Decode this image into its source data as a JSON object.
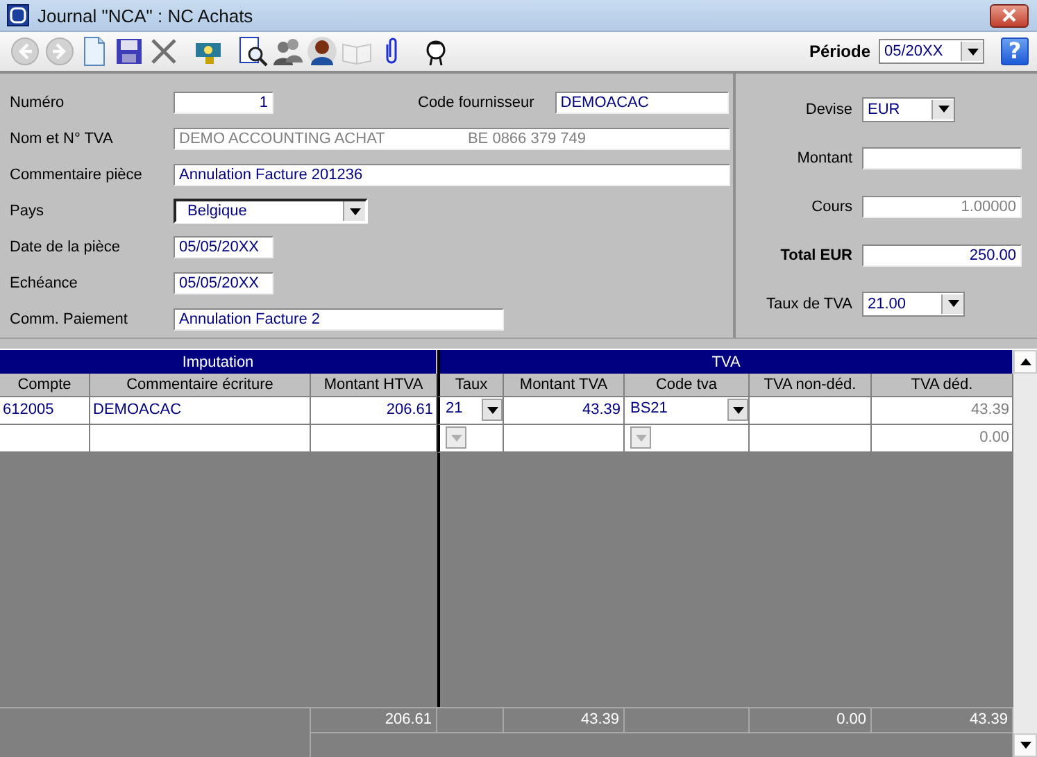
{
  "window": {
    "title": "Journal \"NCA\" : NC Achats"
  },
  "toolbar": {
    "buttons": [
      {
        "kind": "back",
        "disabled": true
      },
      {
        "kind": "forward",
        "disabled": true
      },
      {
        "kind": "new",
        "disabled": false
      },
      {
        "kind": "save",
        "disabled": false
      },
      {
        "kind": "delete",
        "disabled": false
      },
      {
        "kind": "money",
        "disabled": false
      },
      {
        "kind": "preview",
        "disabled": false
      },
      {
        "kind": "users",
        "disabled": false
      },
      {
        "kind": "person",
        "disabled": false
      },
      {
        "kind": "book",
        "disabled": true
      },
      {
        "kind": "clip",
        "disabled": false
      },
      {
        "kind": "face",
        "disabled": false
      }
    ],
    "periode_label": "Période",
    "periode": "05/20XX",
    "help": "?"
  },
  "form": {
    "numero": {
      "label": "Numéro",
      "value": "1"
    },
    "code_fournisseur": {
      "label": "Code fournisseur",
      "value": "DEMOACAC"
    },
    "nom_tva": {
      "label": "Nom et N° TVA",
      "name": "DEMO ACCOUNTING ACHAT",
      "vat": "BE 0866 379 749",
      "disabled": true
    },
    "commentaire": {
      "label": "Commentaire pièce",
      "value": "Annulation Facture 201236"
    },
    "pays": {
      "label": "Pays",
      "value": "Belgique"
    },
    "date": {
      "label": "Date de la pièce",
      "value": "05/05/20XX"
    },
    "echeance": {
      "label": "Echéance",
      "value": "05/05/20XX"
    },
    "comm_paiement": {
      "label": "Comm. Paiement",
      "value": "Annulation Facture 2"
    }
  },
  "currency": {
    "devise": {
      "label": "Devise",
      "value": "EUR"
    },
    "montant": {
      "label": "Montant"
    },
    "cours": {
      "label": "Cours",
      "value": "1.00000",
      "disabled": true
    },
    "total": {
      "label": "Total EUR",
      "value": "250.00"
    },
    "taux": {
      "label": "Taux de TVA",
      "value": "21.00"
    }
  },
  "grid": {
    "groups": [
      {
        "label": "Imputation"
      },
      {
        "label": "TVA"
      }
    ],
    "columns": [
      {
        "label": "Compte",
        "kind": "text"
      },
      {
        "label": "Commentaire écriture",
        "kind": "text"
      },
      {
        "label": "Montant HTVA",
        "kind": "number"
      },
      {
        "label": "Taux",
        "kind": "select"
      },
      {
        "label": "Montant TVA",
        "kind": "number"
      },
      {
        "label": "Code tva",
        "kind": "select"
      },
      {
        "label": "TVA non-déd.",
        "kind": "number"
      },
      {
        "label": "TVA déd.",
        "kind": "computed"
      }
    ],
    "rows": [
      {
        "disabled": false,
        "cells": [
          "612005",
          "DEMOACAC",
          "206.61",
          "21",
          "43.39",
          "BS21",
          null,
          "43.39"
        ]
      },
      {
        "disabled": true,
        "cells": [
          null,
          null,
          null,
          null,
          null,
          null,
          null,
          "0.00"
        ]
      }
    ],
    "totals": {
      "montant_htva": "206.61",
      "montant_tva": "43.39",
      "tva_non_ded": "0.00",
      "tva_ded": "43.39"
    }
  }
}
